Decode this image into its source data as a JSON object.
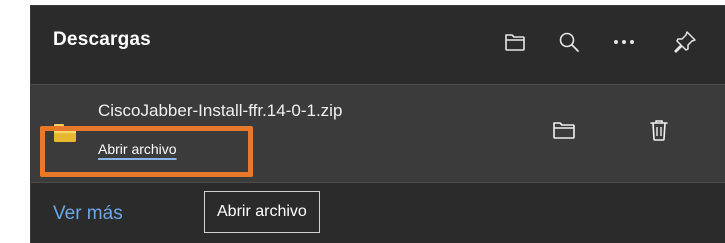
{
  "panel": {
    "title": "Descargas"
  },
  "header_buttons": [
    {
      "name": "open-downloads-folder-button",
      "icon": "folder-icon"
    },
    {
      "name": "search-downloads-button",
      "icon": "search-icon"
    },
    {
      "name": "more-options-button",
      "icon": "more-icon"
    },
    {
      "name": "pin-downloads-button",
      "icon": "pin-icon"
    }
  ],
  "download": {
    "filename": "CiscoJabber-Install-ffr.14-0-1.zip",
    "action_label": "Abrir archivo",
    "icon": "zip-file-icon"
  },
  "item_buttons": [
    {
      "name": "show-in-folder-button",
      "icon": "folder-icon"
    },
    {
      "name": "delete-button",
      "icon": "trash-icon"
    }
  ],
  "footer": {
    "see_more": "Ver más"
  },
  "tooltip": {
    "text": "Abrir archivo"
  },
  "colors": {
    "background": "#2b2b2b",
    "item_background": "#3b3b3b",
    "highlight": "#e8792a",
    "link": "#6aa8e8"
  }
}
